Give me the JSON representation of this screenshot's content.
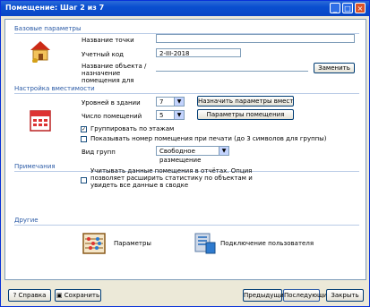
{
  "window": {
    "title": "Помещение: Шаг 2 из 7"
  },
  "general": {
    "section_title": "Базовые параметры",
    "name_label": "Название точки",
    "name_value": "",
    "code_label": "Учетный код",
    "code_value": "2-III-2018",
    "rent_label": "Название объекта / назначение помещения для",
    "rent_value": "",
    "change_button": "Заменить"
  },
  "capacity": {
    "section_title": "Настройка вместимости",
    "floors_label": "Уровней в здании",
    "floors_value": "7",
    "floors_button": "Назначить параметры вместимости",
    "rooms_label": "Число помещений",
    "rooms_value": "5",
    "rooms_button": "Параметры помещения",
    "opt1": "Группировать по этажам",
    "opt1_checked": true,
    "opt2": "Показывать номер помещения при печати (до 3 символов для группы)",
    "opt2_checked": false,
    "type_label": "Вид групп",
    "type_value": "Свободное размещение"
  },
  "notes": {
    "section_title": "Примечания",
    "check_text": "Учитывать данные помещения в отчётах. Опция позволяет расширить статистику по объектам и увидеть все данные в сводке",
    "checked": false
  },
  "other": {
    "section_title": "Другие",
    "params_label": "Параметры",
    "users_label": "Подключение пользователя"
  },
  "footer": {
    "help": "Справка",
    "save": "Сохранить",
    "back": "Предыдущий",
    "next": "Последующий",
    "cancel": "Закрыть"
  }
}
